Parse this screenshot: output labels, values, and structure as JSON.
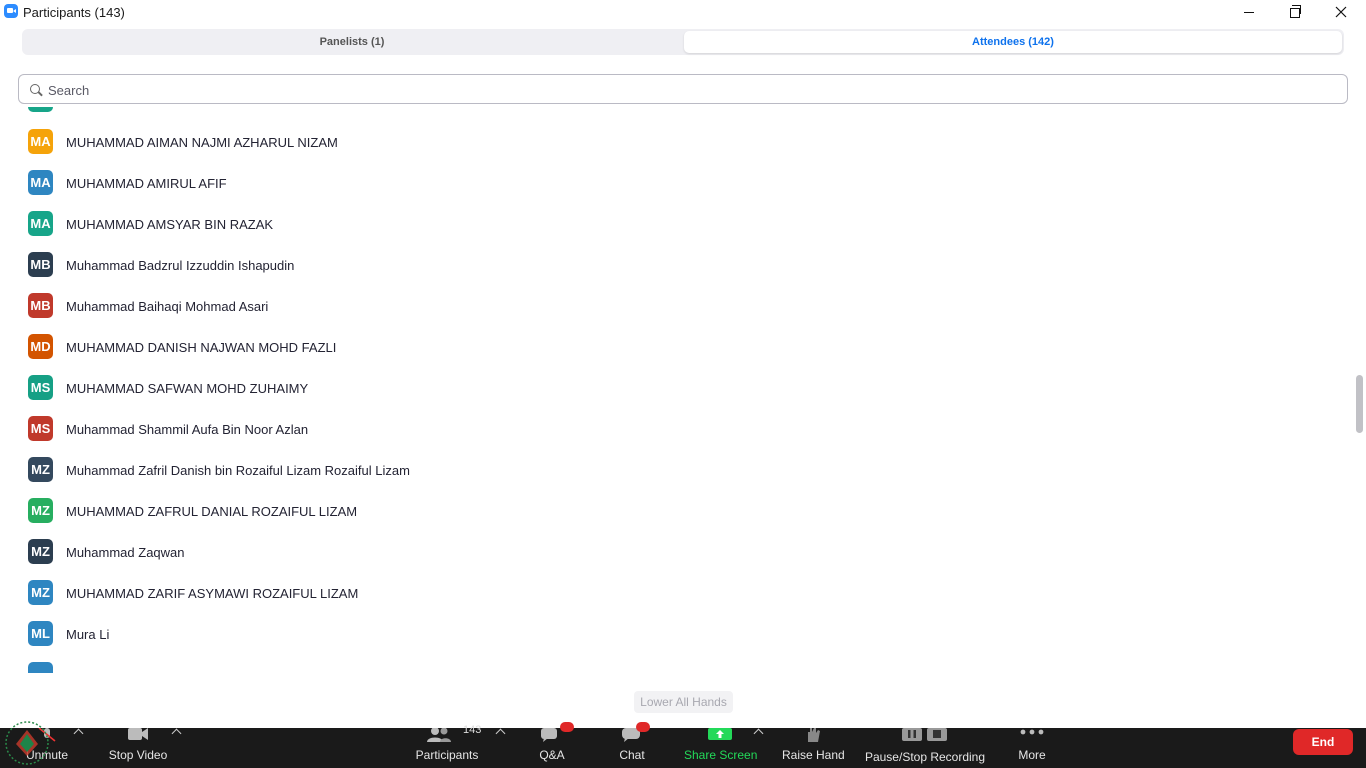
{
  "window": {
    "title": "Participants (143)"
  },
  "tabs": [
    {
      "label": "Panelists (1)"
    },
    {
      "label": "Attendees (142)"
    }
  ],
  "search": {
    "placeholder": "Search"
  },
  "attendees": [
    {
      "initials": "MA",
      "name": "MUHAMMAD AIMAN NAJMI AZHARUL NIZAM",
      "color": "#F5A30A"
    },
    {
      "initials": "MA",
      "name": "MUHAMMAD AMIRUL AFIF",
      "color": "#2E86C1"
    },
    {
      "initials": "MA",
      "name": "MUHAMMAD AMSYAR BIN RAZAK",
      "color": "#17A589"
    },
    {
      "initials": "MB",
      "name": "Muhammad Badzrul Izzuddin Ishapudin",
      "color": "#2C3E50"
    },
    {
      "initials": "MB",
      "name": "Muhammad Baihaqi Mohmad Asari",
      "color": "#C0392B"
    },
    {
      "initials": "MD",
      "name": "MUHAMMAD DANISH NAJWAN MOHD FAZLI",
      "color": "#D35400"
    },
    {
      "initials": "MS",
      "name": "MUHAMMAD SAFWAN MOHD ZUHAIMY",
      "color": "#16A085"
    },
    {
      "initials": "MS",
      "name": "Muhammad Shammil Aufa Bin Noor Azlan",
      "color": "#C0392B"
    },
    {
      "initials": "MZ",
      "name": "Muhammad Zafril Danish bin Rozaiful Lizam Rozaiful Lizam",
      "color": "#34495E"
    },
    {
      "initials": "MZ",
      "name": "MUHAMMAD ZAFRUL DANIAL ROZAIFUL LIZAM",
      "color": "#27AE60"
    },
    {
      "initials": "MZ",
      "name": "Muhammad Zaqwan",
      "color": "#2C3E50"
    },
    {
      "initials": "MZ",
      "name": "MUHAMMAD ZARIF ASYMAWI ROZAIFUL LIZAM",
      "color": "#2E86C1"
    },
    {
      "initials": "ML",
      "name": "Mura Li",
      "color": "#2E86C1"
    }
  ],
  "lower_all_hands": "Lower All Hands",
  "toolbar": {
    "unmute": "Unmute",
    "stop_video": "Stop Video",
    "participants": "Participants",
    "participant_count": "143",
    "qa": "Q&A",
    "chat": "Chat",
    "share_screen": "Share Screen",
    "raise_hand": "Raise Hand",
    "recording": "Pause/Stop Recording",
    "more": "More",
    "end": "End"
  },
  "colors": {
    "accent": "#0E72ED",
    "share_green": "#23D959",
    "end_red": "#E02828",
    "toolbar_bg": "#1a1a1a"
  }
}
